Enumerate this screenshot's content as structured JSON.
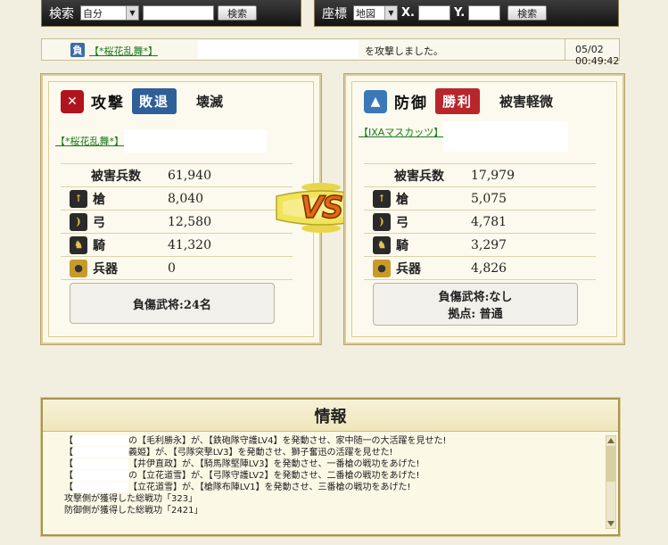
{
  "search_bar": {
    "label": "検索",
    "select_value": "自分",
    "input_value": "",
    "button_label": "検索"
  },
  "coord_bar": {
    "label": "座標",
    "select_value": "地図",
    "x_label": "X.",
    "y_label": "Y.",
    "x_value": "",
    "y_value": "",
    "button_label": "検索"
  },
  "log": {
    "side_badge": "負",
    "attacker_name": "【*桜花乱舞*】",
    "message": "を攻撃しました。",
    "timestamp": "05/02 00:49:42"
  },
  "attacker": {
    "role": "攻撃",
    "outcome": "敗退",
    "result": "壊滅",
    "name": "【*桜花乱舞*】",
    "casualties_label": "被害兵数",
    "casualties_total": "61,940",
    "units": [
      {
        "label": "槍",
        "value": "8,040",
        "icon": "spear-icon"
      },
      {
        "label": "弓",
        "value": "12,580",
        "icon": "bow-icon"
      },
      {
        "label": "騎",
        "value": "41,320",
        "icon": "horse-icon"
      },
      {
        "label": "兵器",
        "value": "0",
        "icon": "siege-weapon-icon"
      }
    ],
    "wounded": "負傷武将:24名"
  },
  "defender": {
    "role": "防御",
    "outcome": "勝利",
    "result": "被害軽微",
    "name": "【IXAマスカッツ】",
    "casualties_label": "被害兵数",
    "casualties_total": "17,979",
    "units": [
      {
        "label": "槍",
        "value": "5,075",
        "icon": "spear-icon"
      },
      {
        "label": "弓",
        "value": "4,781",
        "icon": "bow-icon"
      },
      {
        "label": "騎",
        "value": "3,297",
        "icon": "horse-icon"
      },
      {
        "label": "兵器",
        "value": "4,826",
        "icon": "siege-weapon-icon"
      }
    ],
    "wounded": "負傷武将:なし",
    "base": "拠点: 普通"
  },
  "vs_label": "VS",
  "info": {
    "title": "情報",
    "lines": [
      "の【毛利勝永】が、【鉄砲隊守護LV4】を発動させ、家中随一の大活躍を見せた!",
      "義姫】が、【弓隊突撃LV3】を発動させ、獅子奮迅の活躍を見せた!",
      "【井伊直政】が、【騎馬隊堅陣LV3】を発動させ、一番槍の戦功をあげた!",
      "の【立花道雪】が、【弓隊守護LV2】を発動させ、二番槍の戦功をあげた!",
      "【立花道雪】が、【槍隊布陣LV1】を発動させ、三番槍の戦功をあげた!"
    ],
    "attacker_merit": "攻撃側が獲得した総戦功「323」",
    "defender_merit": "防御側が獲得した総戦功「2421」"
  },
  "colors": {
    "defeat_badge": "#2f5f98",
    "victory_badge": "#b8262b",
    "panel_border": "#d8cd9c",
    "bar_bg": "#1c1c1c"
  }
}
